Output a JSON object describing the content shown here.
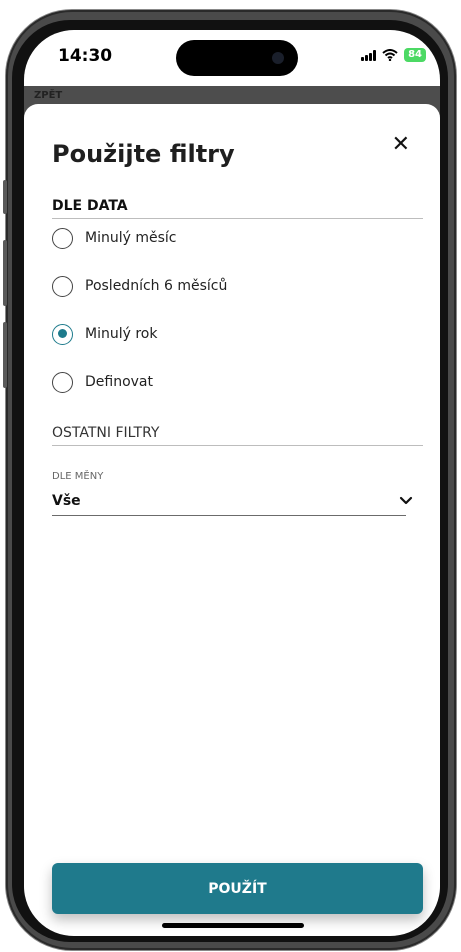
{
  "status": {
    "time": "14:30",
    "battery": "84"
  },
  "underlay": {
    "back_label": "ZPĚT"
  },
  "sheet": {
    "title": "Použijte filtry",
    "close_icon": "close-icon",
    "date_section": {
      "heading": "DLE DATA",
      "options": [
        {
          "label": "Minulý měsíc",
          "selected": false
        },
        {
          "label": "Posledních 6 měsíců",
          "selected": false
        },
        {
          "label": "Minulý rok",
          "selected": true
        },
        {
          "label": "Definovat",
          "selected": false
        }
      ]
    },
    "other_section": {
      "heading": "OSTATNI FILTRY",
      "currency": {
        "label": "DLE MĚNY",
        "value": "Vše"
      }
    },
    "apply_label": "POUŽÍT"
  },
  "colors": {
    "accent": "#1f7a8c",
    "battery": "#4cd964"
  }
}
